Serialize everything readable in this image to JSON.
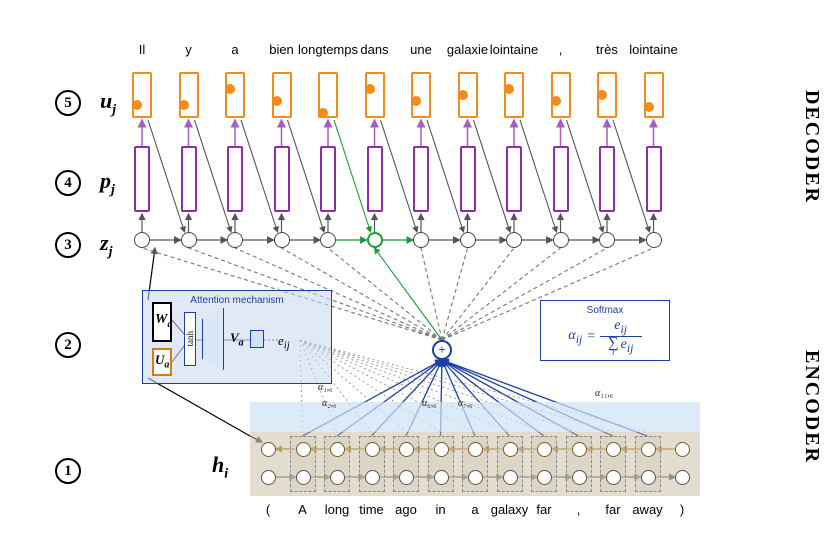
{
  "steps": {
    "s1": "1",
    "s2": "2",
    "s3": "3",
    "s4": "4",
    "s5": "5"
  },
  "row_labels": {
    "u": "u",
    "u_sub": "j",
    "p": "p",
    "p_sub": "j",
    "z": "z",
    "z_sub": "j",
    "h": "h",
    "h_sub": "i"
  },
  "side": {
    "decoder": "DECODER",
    "encoder": "ENCODER"
  },
  "target_words": [
    "Il",
    "y",
    "a",
    "bien",
    "longtemps",
    "dans",
    "une",
    "galaxie",
    "lointaine",
    ",",
    "très",
    "lointaine"
  ],
  "source_words": [
    "(",
    "A",
    "long",
    "time",
    "ago",
    "in",
    "a",
    "galaxy",
    "far",
    ",",
    "far",
    "away",
    ")"
  ],
  "attention": {
    "title": "Attention mechanism",
    "Wa": "W",
    "Wa_sub": "a",
    "Ua": "U",
    "Ua_sub": "a",
    "Va": "V",
    "Va_sub": "a",
    "tanh": "tanh",
    "eij": "e",
    "eij_sub": "ij"
  },
  "softmax": {
    "title": "Softmax",
    "lhs": "α",
    "lhs_sub": "ij",
    "eq": "=",
    "num": "e",
    "num_sub": "ij",
    "den_sum": "∑",
    "den_idx": "i",
    "den": "e",
    "den_sub": "ij"
  },
  "alphas": {
    "a16": "α₁,₆",
    "a26": "α₂,₆",
    "a66": "α₆,₆",
    "a76": "α₇,₆",
    "a116": "α₁₁,₆"
  },
  "plus": "+"
}
